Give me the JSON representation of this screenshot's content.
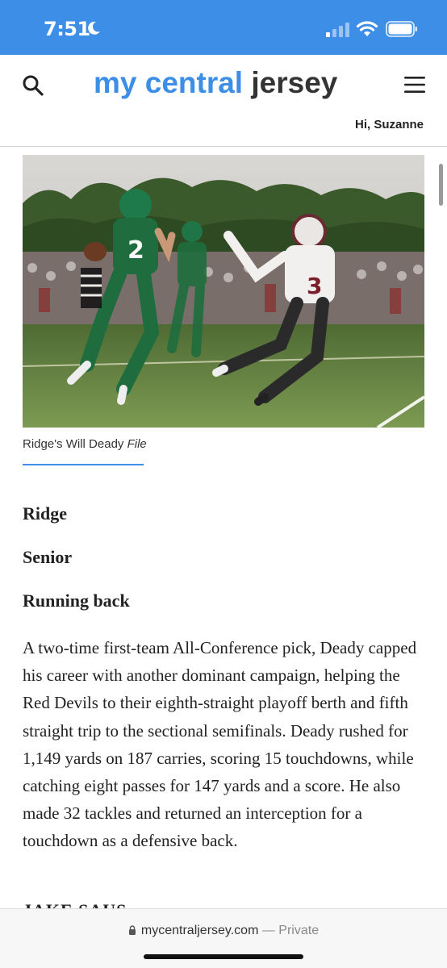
{
  "status_bar": {
    "time": "7:51",
    "icons": [
      "moon-icon",
      "cellular-signal-icon",
      "wifi-icon",
      "battery-icon"
    ]
  },
  "header": {
    "logo_part1": "my central",
    "logo_part2": "jersey",
    "greeting": "Hi, Suzanne",
    "icons": [
      "search-icon",
      "hamburger-menu-icon"
    ]
  },
  "photo": {
    "caption": "Ridge's Will Deady",
    "credit": "File"
  },
  "article": {
    "school": "Ridge",
    "grade": "Senior",
    "position": "Running back",
    "body": "A two-time first-team All-Conference pick, Deady capped his career with another dominant campaign, helping the Red Devils to their eighth-straight playoff berth and fifth straight trip to the sectional semifinals. Deady rushed for 1,149 yards on 187 carries, scoring 15 touchdowns, while catching eight passes for 147 yards and a score. He also made 32 tackles and returned an interception for a touchdown as a defensive back.",
    "next_heading": "JAKE SAUS"
  },
  "browser_bar": {
    "domain": "mycentraljersey.com",
    "separator": " — ",
    "mode": "Private"
  },
  "colors": {
    "brand_blue": "#3d8ee6",
    "logo_dark": "#333333"
  }
}
